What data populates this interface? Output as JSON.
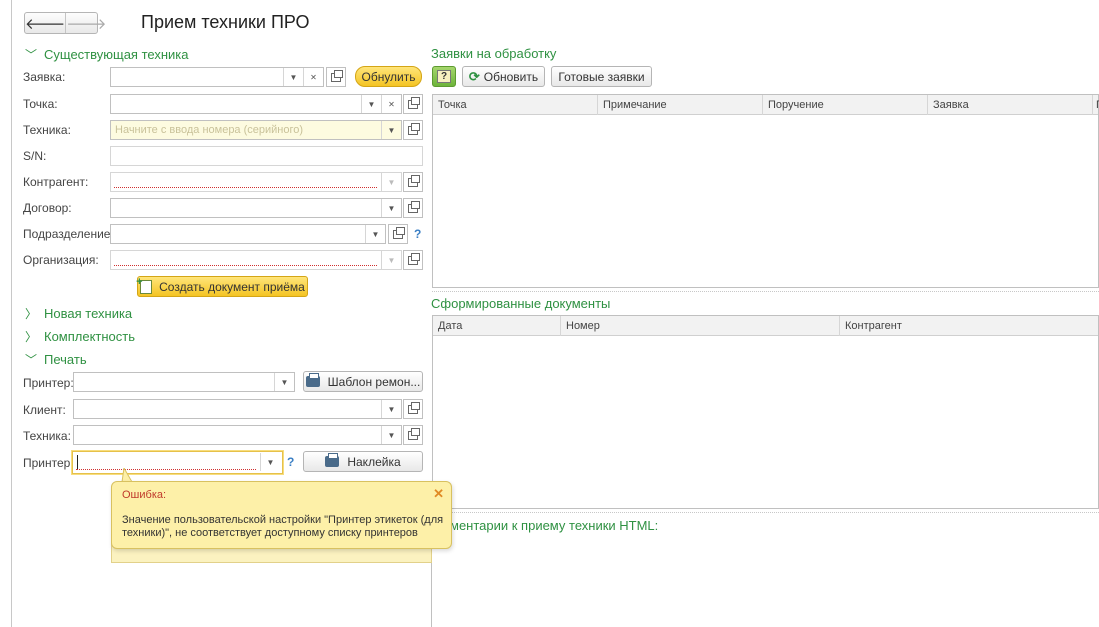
{
  "window": {
    "title": "Прием техники ПРО"
  },
  "nav": {
    "back_icon": "arrow-left-icon",
    "forward_icon": "arrow-right-icon",
    "back_glyph": "🡐",
    "forward_glyph": "🡒"
  },
  "sections": {
    "existing": "Существующая техника",
    "new": "Новая техника",
    "completeness": "Комплектность",
    "print": "Печать"
  },
  "form": {
    "zayavka": {
      "label": "Заявка:",
      "value": ""
    },
    "tochka": {
      "label": "Точка:",
      "value": ""
    },
    "tehnika": {
      "label": "Техника:",
      "placeholder": "Начните с ввода номера (серийного)"
    },
    "sn": {
      "label": "S/N:",
      "value": ""
    },
    "kontragent": {
      "label": "Контрагент:",
      "value": ""
    },
    "dogovor": {
      "label": "Договор:",
      "value": ""
    },
    "podrazdelenie": {
      "label": "Подразделение:",
      "value": ""
    },
    "organizaciya": {
      "label": "Организация:",
      "value": ""
    },
    "reset_button": "Обнулить",
    "create_doc_button": "Создать документ приёма",
    "help_mark": "?"
  },
  "print": {
    "printer1": {
      "label": "Принтер:",
      "value": ""
    },
    "template_button": "Шаблон ремон...",
    "client": {
      "label": "Клиент:",
      "value": ""
    },
    "tehnika": {
      "label": "Техника:",
      "value": ""
    },
    "printer2": {
      "label": "Принтер:",
      "value": ""
    },
    "sticker_button": "Наклейка"
  },
  "requests_panel": {
    "title": "Заявки на обработку",
    "help_button": "?",
    "refresh_button": "Обновить",
    "ready_button": "Готовые заявки",
    "columns": [
      "Точка",
      "Примечание",
      "Поручение",
      "Заявка",
      "П"
    ],
    "rows": []
  },
  "documents_panel": {
    "title": "Сформированные документы",
    "columns": [
      "Дата",
      "Номер",
      "Контрагент"
    ],
    "rows": []
  },
  "comments_panel": {
    "title": "Комментарии к приему техники HTML:",
    "visible_part": "ментарии к приему техники HTML:"
  },
  "error_tooltip": {
    "title": "Ошибка:",
    "text": "Значение пользовательской настройки \"Принтер этикеток (для техники)\", не соответствует доступному списку принтеров",
    "close_glyph": "✕"
  },
  "colors": {
    "accent_green": "#2f9142",
    "button_yellow": "#f4c424",
    "tooltip_bg": "#fdf0a8",
    "error_red": "#c0392b"
  }
}
